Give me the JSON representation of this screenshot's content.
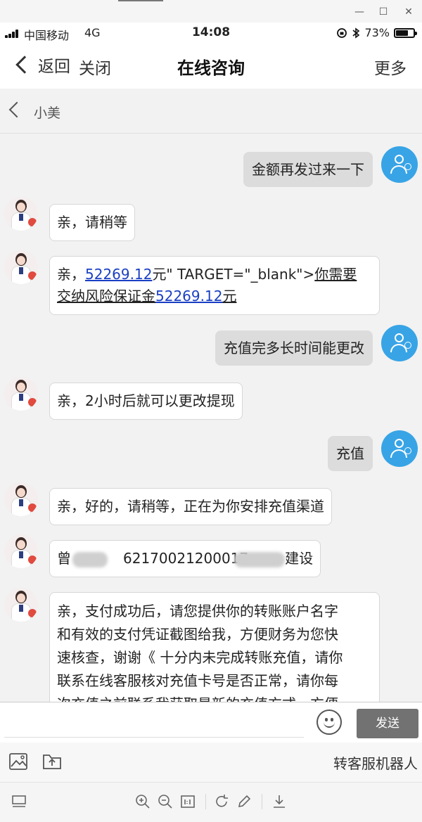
{
  "window": {
    "minimize_glyph": "—",
    "maximize_glyph": "☐",
    "close_glyph": "✕"
  },
  "status_bar": {
    "carrier": "中国移动",
    "network": "4G",
    "time": "14:08",
    "battery": "73%",
    "battery_level": 0.73
  },
  "nav": {
    "back": "返回",
    "close": "关闭",
    "title": "在线咨询",
    "more": "更多"
  },
  "chat_header": {
    "name": "小美"
  },
  "messages": [
    {
      "from": "user",
      "text": "金额再发过来一下"
    },
    {
      "from": "agent",
      "text": "亲，请稍等"
    },
    {
      "from": "agent",
      "prefix": "亲，",
      "link_amount": "52269.12",
      "mid": "元\" TARGET=\"_blank\">",
      "underlined_line1": "你需要",
      "underlined_line2": "交纳风险保证金",
      "link_amount2": "52269.12",
      "suffix": "元"
    },
    {
      "from": "user",
      "text": "充值完多长时间能更改"
    },
    {
      "from": "agent",
      "text": "亲，2小时后就可以更改提现"
    },
    {
      "from": "user",
      "text": "充值"
    },
    {
      "from": "agent",
      "text": "亲，好的，请稍等，正在为你安排充值渠道"
    },
    {
      "from": "agent",
      "name": "曾",
      "account": "62170021200017",
      "bank": "建设"
    },
    {
      "from": "agent",
      "lines": [
        "亲，支付成功后，请您提供你的转账账户名字",
        "和有效的支付凭证截图给我，方便财务为您快",
        "速核查，谢谢《 十分内未完成转账充值，请你",
        "联系在线客服核对充值卡号是否正常，请你每",
        "次充值之前联系我获取最新的充值方式，方便"
      ]
    }
  ],
  "input": {
    "placeholder": "",
    "value": "",
    "send": "发送"
  },
  "toolbar": {
    "robot": "转客服机器人"
  },
  "colors": {
    "user_avatar": "#38a4e6",
    "link": "#1a3fc4",
    "send_button": "#727272"
  }
}
